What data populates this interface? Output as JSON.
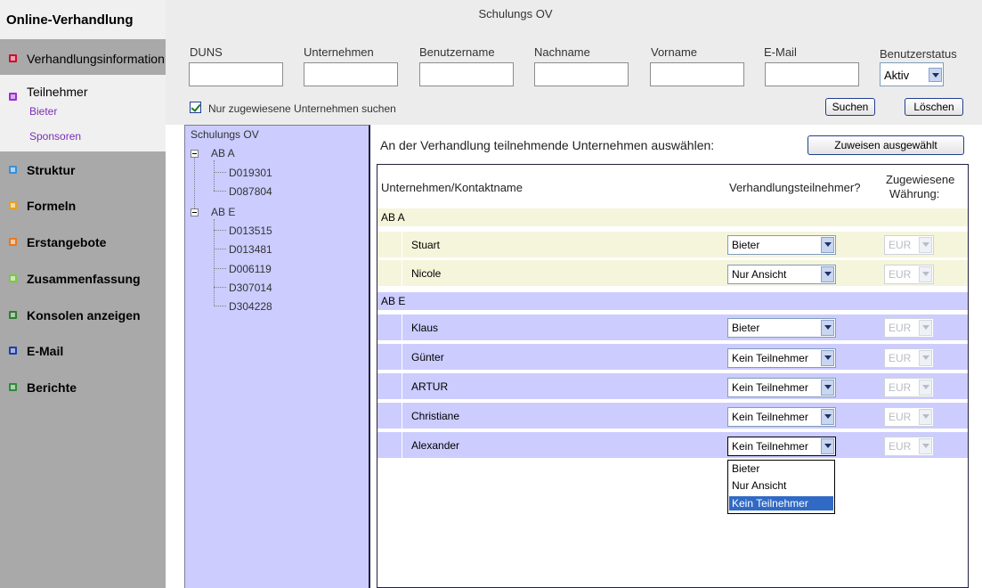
{
  "sidebar": {
    "title": "Online-Verhandlung",
    "items": [
      {
        "label": "Verhandlungsinformation",
        "color": "#c8102e"
      },
      {
        "label": "Teilnehmer",
        "color": "#9b30d0"
      },
      {
        "label": "Struktur",
        "color": "#3a8fd8"
      },
      {
        "label": "Formeln",
        "color": "#e8a020"
      },
      {
        "label": "Erstangebote",
        "color": "#e87820"
      },
      {
        "label": "Zusammenfassung",
        "color": "#7ac943"
      },
      {
        "label": "Konsolen anzeigen",
        "color": "#2e7d32"
      },
      {
        "label": "E-Mail",
        "color": "#1e3fa8"
      },
      {
        "label": "Berichte",
        "color": "#2e8b3a"
      }
    ],
    "sub_items": [
      "Bieter",
      "Sponsoren"
    ]
  },
  "header": {
    "title": "Schulungs OV",
    "fields": [
      "DUNS",
      "Unternehmen",
      "Benutzername",
      "Nachname",
      "Vorname",
      "E-Mail"
    ],
    "status_label": "Benutzerstatus",
    "status_value": "Aktiv",
    "checkbox_label": "Nur zugewiesene Unternehmen suchen",
    "search_button": "Suchen",
    "clear_button": "Löschen"
  },
  "tree": {
    "root": "Schulungs OV",
    "groups": [
      {
        "label": "AB A",
        "children": [
          "D019301",
          "D087804"
        ]
      },
      {
        "label": "AB E",
        "children": [
          "D013515",
          "D013481",
          "D006119",
          "D307014",
          "D304228"
        ]
      }
    ]
  },
  "main": {
    "heading": "An der Verhandlung teilnehmende Unternehmen auswählen:",
    "assign_button": "Zuweisen ausgewählt",
    "columns": [
      "Unternehmen/Kontaktname",
      "Verhandlungsteilnehmer?",
      "Zugewiesene",
      "Währung:"
    ],
    "groups": [
      {
        "label": "AB A",
        "rows": [
          {
            "name": "Stuart",
            "role": "Bieter",
            "currency": "EUR"
          },
          {
            "name": "Nicole",
            "role": "Nur Ansicht",
            "currency": "EUR"
          }
        ]
      },
      {
        "label": "AB E",
        "rows": [
          {
            "name": "Klaus",
            "role": "Bieter",
            "currency": "EUR"
          },
          {
            "name": "Günter",
            "role": "Kein Teilnehmer",
            "currency": "EUR"
          },
          {
            "name": "ARTUR",
            "role": "Kein Teilnehmer",
            "currency": "EUR"
          },
          {
            "name": "Christiane",
            "role": "Kein Teilnehmer",
            "currency": "EUR"
          },
          {
            "name": "Alexander",
            "role": "Kein Teilnehmer",
            "currency": "EUR"
          }
        ]
      }
    ]
  },
  "dropdown": {
    "options": [
      "Bieter",
      "Nur Ansicht",
      "Kein Teilnehmer"
    ],
    "selected": "Kein Teilnehmer"
  },
  "colors": {
    "sidebar_bg": "#a9a9a9",
    "tree_bg": "#ccccff",
    "group_a_bg": "#f5f5dc",
    "group_e_bg": "#ccccff",
    "highlight": "#316ac5"
  }
}
